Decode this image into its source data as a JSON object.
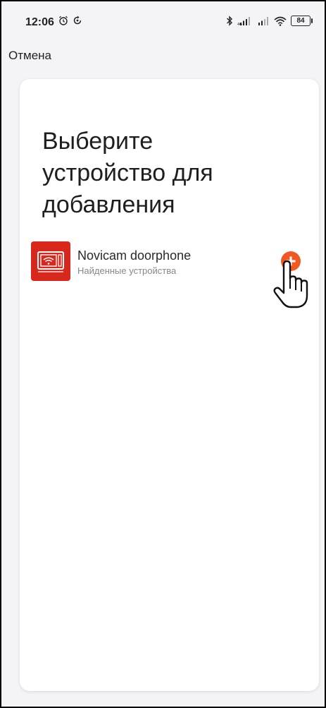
{
  "status_bar": {
    "time": "12:06",
    "battery": "84",
    "left_icons": [
      "alarm-icon",
      "sync-icon"
    ],
    "right_icons": [
      "bluetooth-icon",
      "signal-icon",
      "signal-icon",
      "wifi-icon",
      "battery-icon"
    ]
  },
  "nav": {
    "cancel_label": "Отмена"
  },
  "main": {
    "title": "Выберите устройство для добавления",
    "device": {
      "name": "Novicam doorphone",
      "subtitle": "Найденные устройства",
      "icon": "doorphone-monitor-icon",
      "add_icon": "plus-icon"
    }
  },
  "colors": {
    "accent": "#f05a22",
    "device_red": "#d8271c",
    "background": "#f4f4f6",
    "card": "#ffffff"
  }
}
